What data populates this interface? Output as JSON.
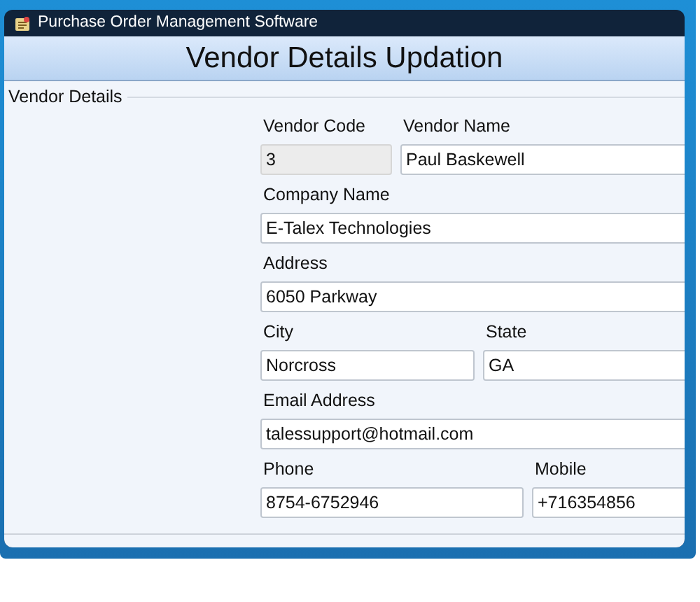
{
  "window": {
    "title": "Purchase Order Management Software"
  },
  "header": {
    "title": "Vendor Details Updation"
  },
  "group": {
    "label": "Vendor Details"
  },
  "rows": [
    [
      {
        "label": "Vendor Code",
        "value": "3",
        "disabled": true
      },
      {
        "label": "Vendor Name",
        "value": "Paul Baskewell",
        "disabled": false
      }
    ],
    [
      {
        "label": "Company Name",
        "value": "E-Talex Technologies",
        "disabled": false
      }
    ],
    [
      {
        "label": "Address",
        "value": "6050 Parkway",
        "disabled": false
      }
    ],
    [
      {
        "label": "City",
        "value": "Norcross",
        "disabled": false
      },
      {
        "label": "State",
        "value": "GA",
        "disabled": false
      }
    ],
    [
      {
        "label": "Email Address",
        "value": "talessupport@hotmail.com",
        "disabled": false
      }
    ],
    [
      {
        "label": "Phone",
        "value": "8754-6752946",
        "disabled": false
      },
      {
        "label": "Mobile",
        "value": "+716354856",
        "disabled": false
      }
    ]
  ]
}
